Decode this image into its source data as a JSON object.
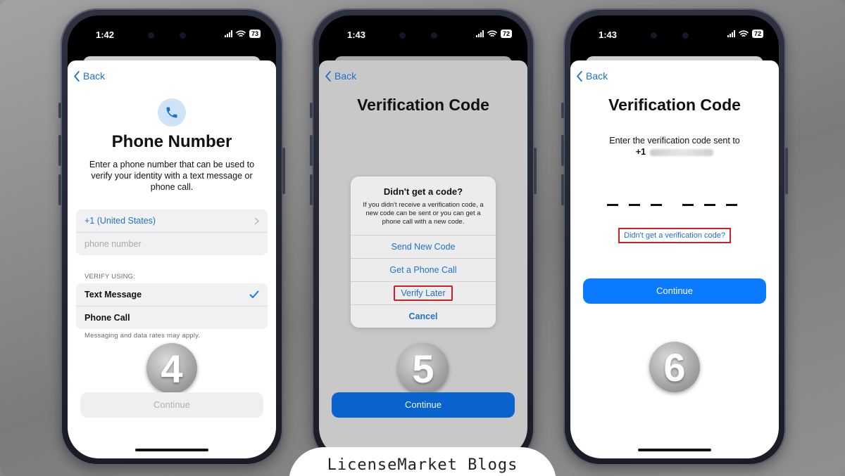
{
  "brand": {
    "footer_text": "LicenseMarket Blogs"
  },
  "colors": {
    "ios_blue": "#0a7aff",
    "link_blue": "#1f72c9",
    "highlight_red": "#c5232a"
  },
  "phone1": {
    "time": "1:42",
    "battery": "73",
    "back_label": "Back",
    "icon": "phone-icon",
    "title": "Phone Number",
    "subtitle": "Enter a phone number that can be used to verify your identity with a text message or phone call.",
    "country_code": "+1 (United States)",
    "phone_placeholder": "phone number",
    "verify_caption": "VERIFY USING:",
    "options": [
      {
        "label": "Text Message",
        "selected": true
      },
      {
        "label": "Phone Call",
        "selected": false
      }
    ],
    "rates_note": "Messaging and data rates may apply.",
    "step": "4",
    "continue_label": "Continue"
  },
  "phone2": {
    "time": "1:43",
    "battery": "72",
    "back_label": "Back",
    "title": "Verification Code",
    "alert": {
      "title": "Didn't get a code?",
      "message": "If you didn't receive a verification code, a new code can be sent or you can get a phone call with a new code.",
      "send_new": "Send New Code",
      "phone_call": "Get a Phone Call",
      "verify_later": "Verify Later",
      "cancel": "Cancel"
    },
    "step": "5",
    "continue_label": "Continue"
  },
  "phone3": {
    "time": "1:43",
    "battery": "72",
    "back_label": "Back",
    "title": "Verification Code",
    "instructions": "Enter the verification code sent to",
    "number_prefix": "+1",
    "resend_link": "Didn't get a verification code?",
    "step": "6",
    "continue_label": "Continue"
  }
}
